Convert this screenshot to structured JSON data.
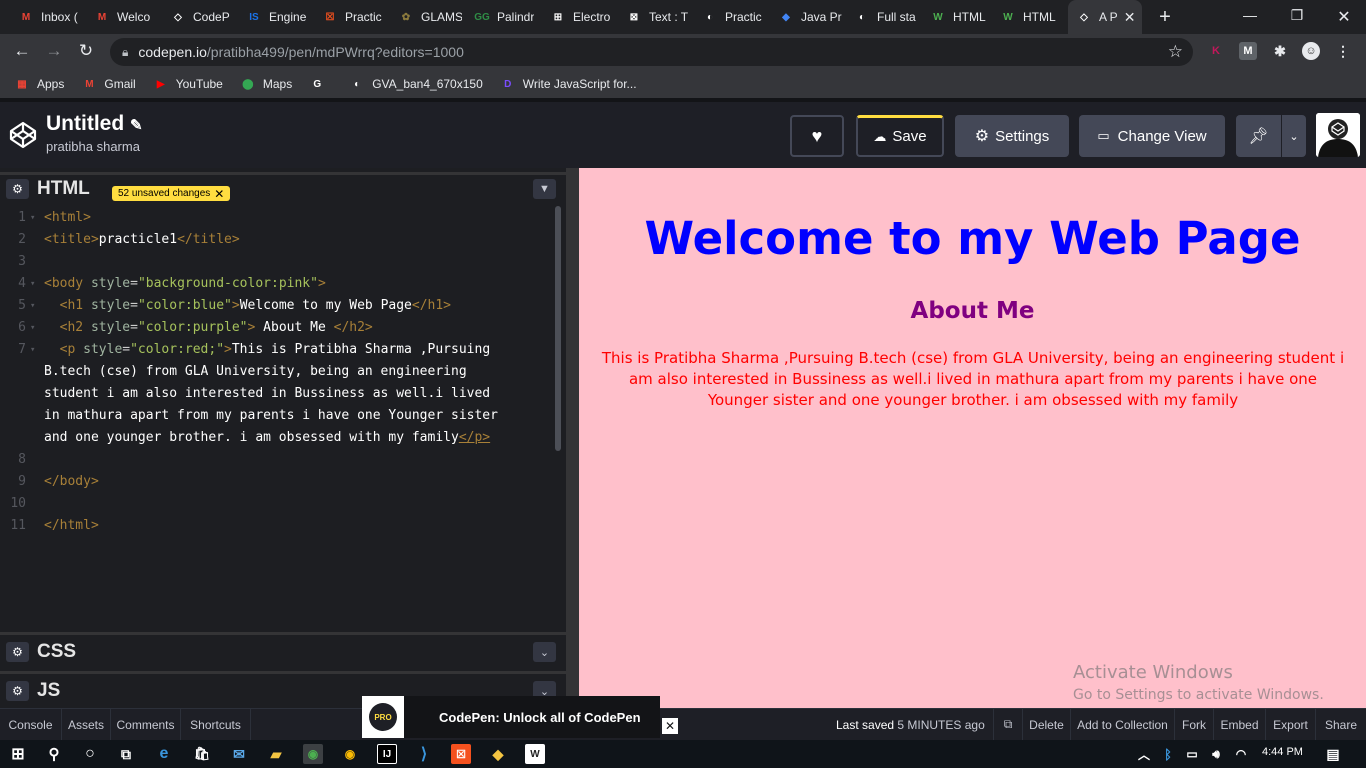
{
  "browser": {
    "tabs": [
      {
        "label": "Inbox (",
        "icon": "gmail-icon",
        "color": "#ea4335",
        "glyph": "M"
      },
      {
        "label": "Welco",
        "icon": "gmail-icon",
        "color": "#ea4335",
        "glyph": "M"
      },
      {
        "label": "CodeP",
        "icon": "codepen-icon",
        "color": "#ffffff",
        "glyph": "◇"
      },
      {
        "label": "Engine",
        "icon": "is-icon",
        "color": "#1a73e8",
        "glyph": "IS"
      },
      {
        "label": "Practic",
        "icon": "practice-icon",
        "color": "#f4511e",
        "glyph": "☒"
      },
      {
        "label": "GLAMS",
        "icon": "glams-icon",
        "color": "#8d7b3d",
        "glyph": "✿"
      },
      {
        "label": "Palindr",
        "icon": "gfg-icon",
        "color": "#2f8d46",
        "glyph": "GG"
      },
      {
        "label": "Electro",
        "icon": "electron-icon",
        "color": "#ffffff",
        "glyph": "⊞"
      },
      {
        "label": "Text : T",
        "icon": "tool-icon",
        "color": "#ffffff",
        "glyph": "⊠"
      },
      {
        "label": "Practic",
        "icon": "globe-icon",
        "color": "#ffffff",
        "glyph": "◐"
      },
      {
        "label": "Java Pr",
        "icon": "java-icon",
        "color": "#4285f4",
        "glyph": "◆"
      },
      {
        "label": "Full sta",
        "icon": "globe-icon",
        "color": "#ffffff",
        "glyph": "◐"
      },
      {
        "label": "HTML",
        "icon": "w3schools-icon",
        "color": "#4caf50",
        "glyph": "W"
      },
      {
        "label": "HTML",
        "icon": "w3schools-icon",
        "color": "#4caf50",
        "glyph": "W"
      },
      {
        "label": "A P",
        "icon": "codepen-icon",
        "color": "#ffffff",
        "glyph": "◇",
        "active": true
      }
    ],
    "url_host": "codepen.io",
    "url_path": "/pratibha499/pen/mdPWrrq?editors=1000",
    "bookmarks": [
      {
        "label": "Apps",
        "icon": "apps-grid-icon",
        "color": "#ea4335",
        "glyph": "▦"
      },
      {
        "label": "Gmail",
        "icon": "gmail-icon",
        "color": "#ea4335",
        "glyph": "M"
      },
      {
        "label": "YouTube",
        "icon": "youtube-icon",
        "color": "#ff0000",
        "glyph": "▶"
      },
      {
        "label": "Maps",
        "icon": "maps-icon",
        "color": "#34a853",
        "glyph": "⬤"
      },
      {
        "label": "",
        "icon": "google-icon",
        "color": "#ffffff",
        "glyph": "G"
      },
      {
        "label": "GVA_ban4_670x150",
        "icon": "globe-icon",
        "color": "#ffffff",
        "glyph": "◐"
      },
      {
        "label": "Write JavaScript for...",
        "icon": "js-bookmark-icon",
        "color": "#7c4dff",
        "glyph": "D"
      }
    ]
  },
  "codepen": {
    "title": "Untitled",
    "author": "pratibha sharma",
    "buttons": {
      "save": "Save",
      "settings": "Settings",
      "change_view": "Change View"
    },
    "html_panel": {
      "title": "HTML",
      "badge": "52 unsaved changes"
    },
    "css_panel": {
      "title": "CSS"
    },
    "js_panel": {
      "title": "JS"
    },
    "code_lines": [
      {
        "num": "1",
        "html": "<span class='tg'>&lt;html&gt;</span>"
      },
      {
        "num": "2",
        "html": "<span class='tg'>&lt;title&gt;</span><span class='tx'>practicle1</span><span class='tg'>&lt;/title&gt;</span>"
      },
      {
        "num": "3",
        "html": ""
      },
      {
        "num": "4",
        "html": "<span class='tg'>&lt;body</span> <span class='at'>style</span>=<span class='av'>\"background-color:pink\"</span><span class='tg'>&gt;</span>"
      },
      {
        "num": "5",
        "html": "  <span class='tg'>&lt;h1</span> <span class='at'>style</span>=<span class='av'>\"color:blue\"</span><span class='tg'>&gt;</span><span class='tx'>Welcome to my Web Page</span><span class='tg'>&lt;/h1&gt;</span>"
      },
      {
        "num": "6",
        "html": "  <span class='tg'>&lt;h2</span> <span class='at'>style</span>=<span class='av'>\"color:purple\"</span><span class='tg'>&gt;</span><span class='tx'> About Me </span><span class='tg'>&lt;/h2&gt;</span>"
      },
      {
        "num": "7",
        "html": "  <span class='tg'>&lt;p</span> <span class='at'>style</span>=<span class='av'>\"color:red;\"</span><span class='tg'>&gt;</span><span class='tx'>This is Pratibha Sharma ,Pursuing</span>"
      },
      {
        "num": "",
        "html": "<span class='tx'>B.tech (cse) from GLA University, being an engineering</span>"
      },
      {
        "num": "",
        "html": "<span class='tx'>student i am also interested in Bussiness as well.i lived</span>"
      },
      {
        "num": "",
        "html": "<span class='tx'>in mathura apart from my parents i have one Younger sister</span>"
      },
      {
        "num": "",
        "html": "<span class='tx'>and one younger brother. i am obsessed with my family</span><span class='tg' style='text-decoration:underline'>&lt;/p&gt;</span>"
      },
      {
        "num": "8",
        "html": ""
      },
      {
        "num": "9",
        "html": "<span class='tg'>&lt;/body&gt;</span>"
      },
      {
        "num": "10",
        "html": ""
      },
      {
        "num": "11",
        "html": "<span class='tg'>&lt;/html&gt;</span>"
      }
    ],
    "preview": {
      "h1": "Welcome to my Web Page",
      "h2": "About Me",
      "p": "This is Pratibha Sharma ,Pursuing B.tech (cse) from GLA University, being an engineering student i am also interested in Bussiness as well.i lived in mathura apart from my parents i have one Younger sister and one younger brother. i am obsessed with my family"
    },
    "watermark": {
      "title": "Activate Windows",
      "subtitle": "Go to Settings to activate Windows."
    },
    "footer": {
      "console": "Console",
      "assets": "Assets",
      "comments": "Comments",
      "shortcuts": "Shortcuts",
      "promo_badge": "PRO",
      "promo": "CodePen: Unlock all of CodePen",
      "last_saved_label": "Last saved",
      "last_saved_value": "5 MINUTES ago",
      "delete": "Delete",
      "add_to_collection": "Add to Collection",
      "fork": "Fork",
      "embed": "Embed",
      "export": "Export",
      "share": "Share"
    }
  },
  "taskbar": {
    "clock": "4:44 PM"
  },
  "colors": {
    "preview_bg": "#ffc0cb",
    "h1": "#0000ff",
    "h2": "#800080",
    "p": "#ff0000",
    "badge": "#ffdd40"
  }
}
